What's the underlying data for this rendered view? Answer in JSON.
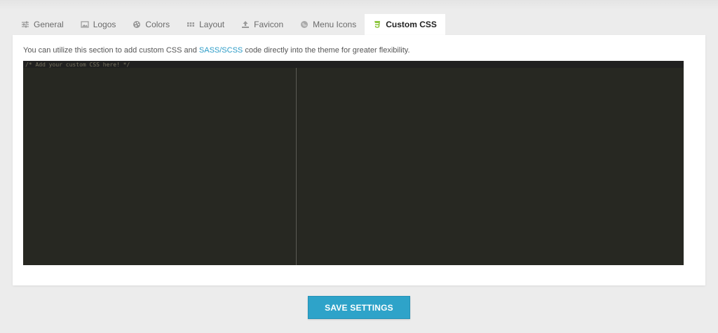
{
  "tabs": [
    {
      "label": "General",
      "icon": "sliders-icon"
    },
    {
      "label": "Logos",
      "icon": "image-icon"
    },
    {
      "label": "Colors",
      "icon": "palette-icon"
    },
    {
      "label": "Layout",
      "icon": "grid-icon"
    },
    {
      "label": "Favicon",
      "icon": "upload-icon"
    },
    {
      "label": "Menu Icons",
      "icon": "globe-icon"
    },
    {
      "label": "Custom CSS",
      "icon": "css3-icon",
      "active": true
    }
  ],
  "panel": {
    "description_before": "You can utilize this section to add custom CSS and ",
    "description_link": "SASS/SCSS",
    "description_after": " code directly into the theme for greater flexibility.",
    "editor_content": "/* Add your custom CSS here! */"
  },
  "save_button_label": "SAVE SETTINGS",
  "colors": {
    "accent": "#2ea3c9",
    "editor_bg": "#272822",
    "css3_icon": "#8dc63f",
    "link": "#2a9bc7"
  }
}
